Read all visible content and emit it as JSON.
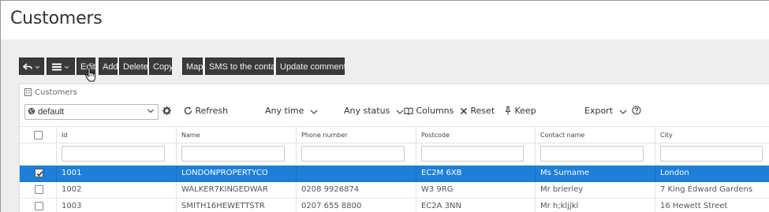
{
  "page": {
    "title": "Customers"
  },
  "toolbar": {
    "back_icon": "undo-arrow-icon",
    "menu_icon": "hamburger-menu-icon",
    "buttons": [
      "Edit",
      "Add",
      "Delete",
      "Copy",
      "Map",
      "SMS to the contact",
      "Update comments"
    ]
  },
  "panel": {
    "title": "Customers",
    "title_icon": "building-icon",
    "view_select": "default",
    "refresh_label": "Refresh",
    "time_filter": "Any time",
    "status_filter": "Any status",
    "columns_label": "Columns",
    "reset_label": "Reset",
    "keep_label": "Keep",
    "export_label": "Export",
    "help_icon": "question-circle-icon"
  },
  "table": {
    "columns": [
      "Id",
      "Name",
      "Phone number",
      "Postcode",
      "Contact name",
      "City"
    ],
    "rows": [
      {
        "checked": true,
        "selected": true,
        "cells": [
          "1001",
          "LONDONPROPERTYCO",
          "",
          "EC2M 6XB",
          "Ms Surname",
          "London"
        ]
      },
      {
        "checked": false,
        "selected": false,
        "cells": [
          "1002",
          "WALKER7KINGEDWAR",
          "0208 9926874",
          "W3 9RG",
          "Mr brierley",
          "7 King Edward Gardens"
        ]
      },
      {
        "checked": false,
        "selected": false,
        "cells": [
          "1003",
          "SMITH16HEWETTSTR",
          "0207 655 8800",
          "EC2A 3NN",
          "Mr h;kljjkl",
          "16 Hewett Street"
        ]
      }
    ]
  },
  "colors": {
    "selected_row": "#1e7fd8",
    "toolbar_button": "#3a3a3a",
    "page_background": "#eeeeee"
  }
}
